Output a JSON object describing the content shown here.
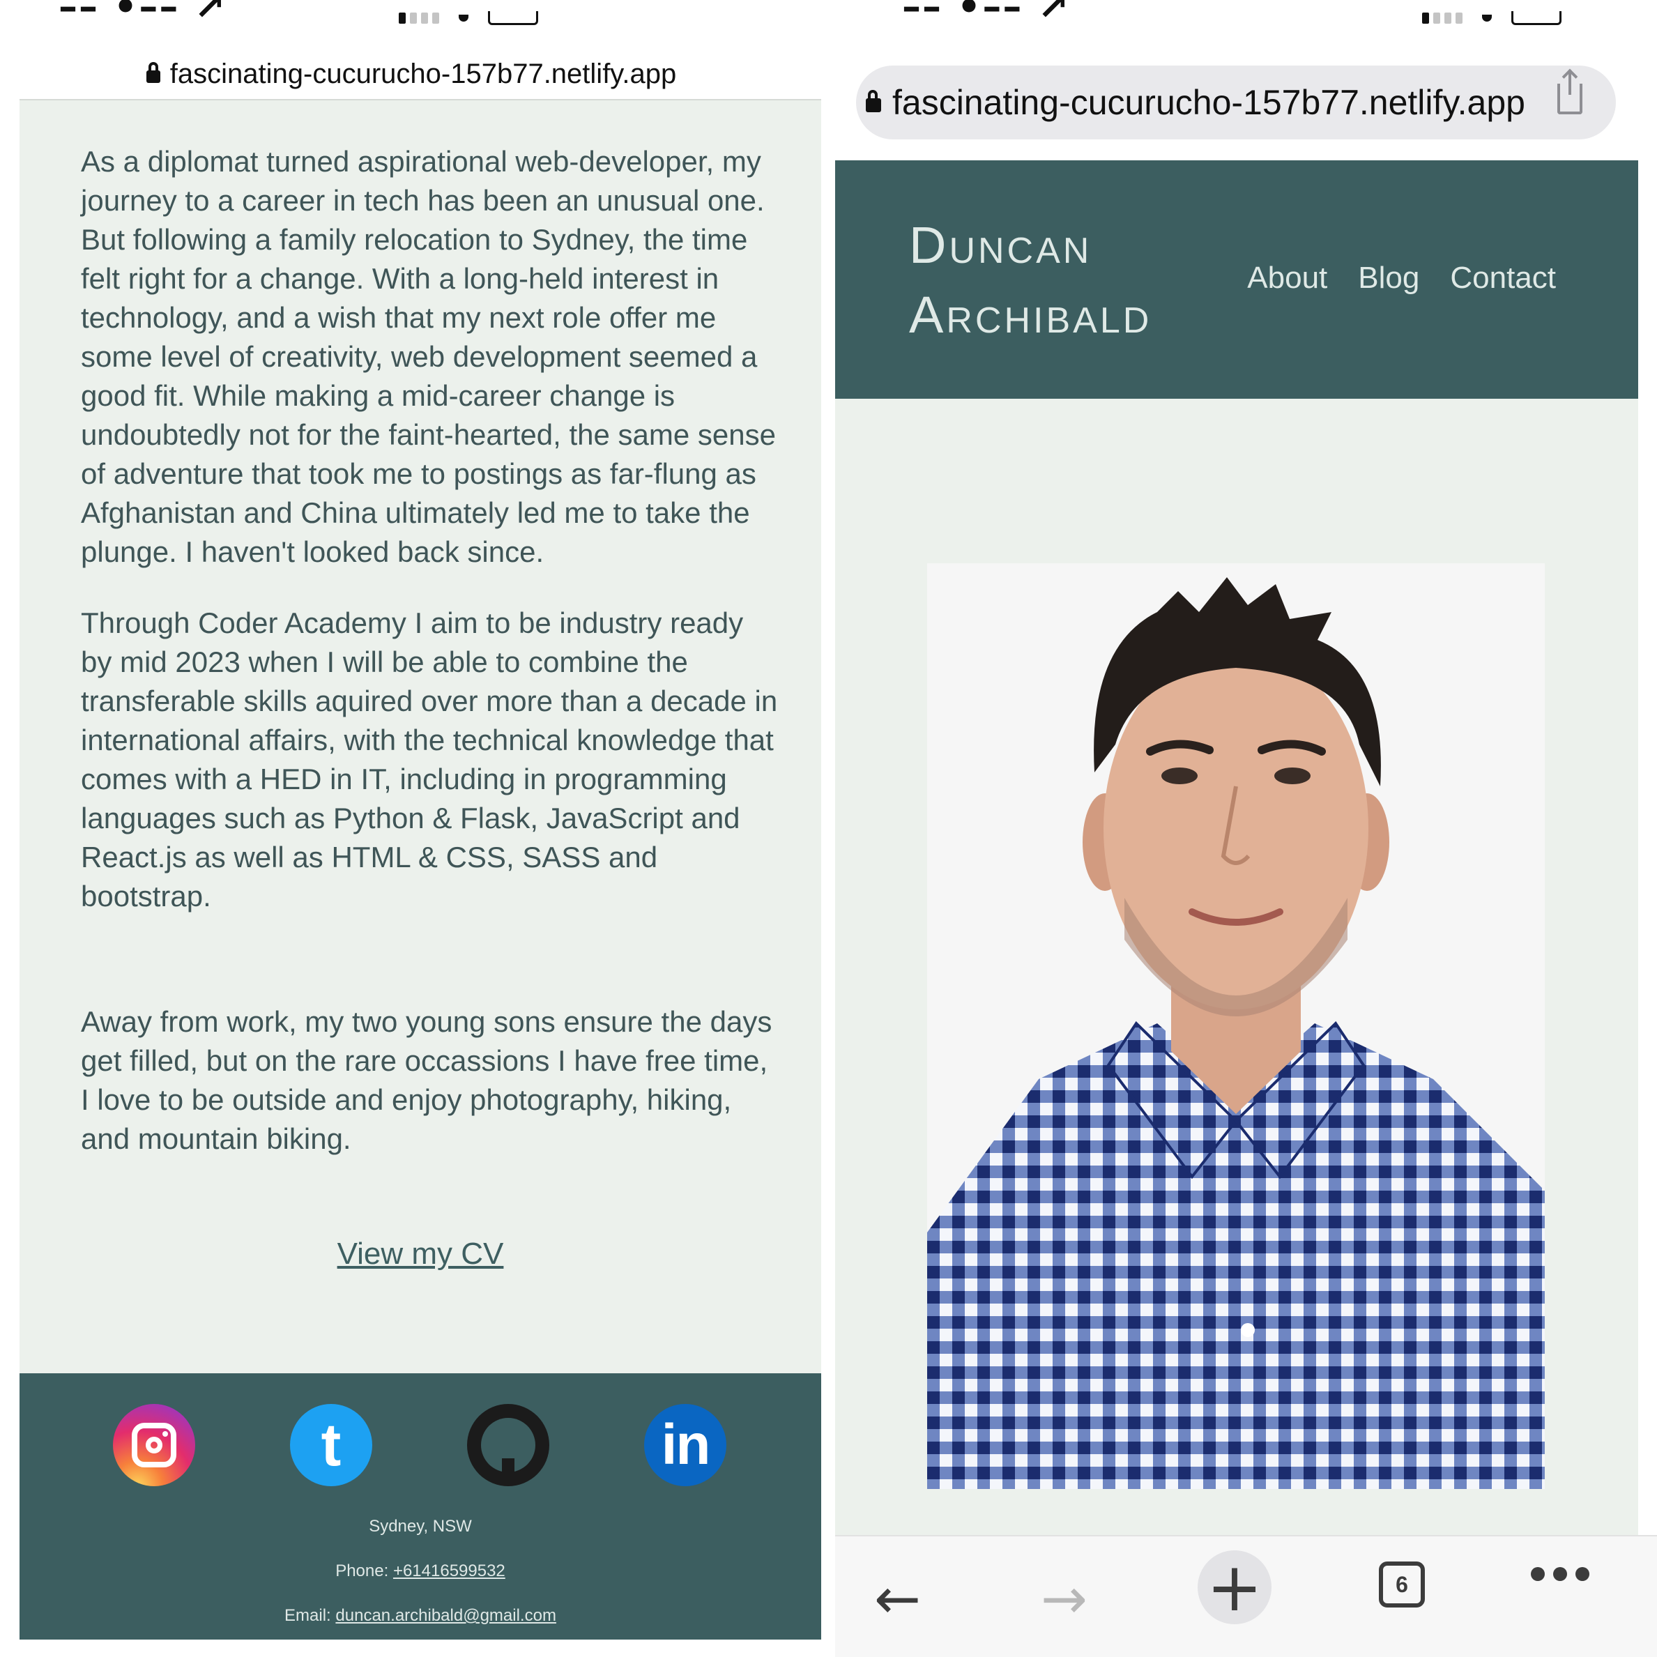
{
  "left_screen": {
    "url": "fascinating-cucurucho-157b77.netlify.app",
    "paragraphs": [
      "As a diplomat turned aspirational web-developer, my journey to a career in tech has been an unusual one. But following a family relocation to Sydney, the time felt right for a change. With a long-held interest in technology, and a wish that my next role offer me some level of creativity, web development seemed a good fit. While making a mid-career change is undoubtedly not for the faint-hearted, the same sense of adventure that took me to postings as far-flung as Afghanistan and China ultimately led me to take the plunge. I haven't looked back since.",
      "Through Coder Academy I aim to be industry ready by mid 2023 when I will be able to combine the transferable skills aquired over more than a decade in international affairs, with the technical knowledge that comes with a HED in IT, including in programming languages such as Python & Flask, JavaScript and React.js as well as HTML & CSS, SASS and bootstrap.",
      "Away from work, my two young sons ensure the days get filled, but on the rare occassions I have free time, I love to be outside and enjoy photography, hiking, and mountain biking."
    ],
    "cv_link": "View my CV",
    "footer": {
      "social": [
        {
          "icon": "instagram-icon"
        },
        {
          "icon": "twitter-icon",
          "glyph": "t"
        },
        {
          "icon": "github-icon"
        },
        {
          "icon": "linkedin-icon",
          "glyph": "in"
        }
      ],
      "location": "Sydney, NSW",
      "phone_label": "Phone: ",
      "phone": "+61416599532",
      "email_label": "Email: ",
      "email": "duncan.archibald@gmail.com"
    }
  },
  "right_screen": {
    "url": "fascinating-cucurucho-157b77.netlify.app",
    "brand_first": "Duncan",
    "brand_last": "Archibald",
    "nav": [
      "About",
      "Blog",
      "Contact"
    ],
    "toolbar": {
      "back": "←",
      "forward": "→",
      "new_tab": "+",
      "tab_count": "6"
    }
  },
  "colors": {
    "page_bg": "#ecf1ec",
    "header_bg": "#3c5e60",
    "text": "#3f5557"
  }
}
